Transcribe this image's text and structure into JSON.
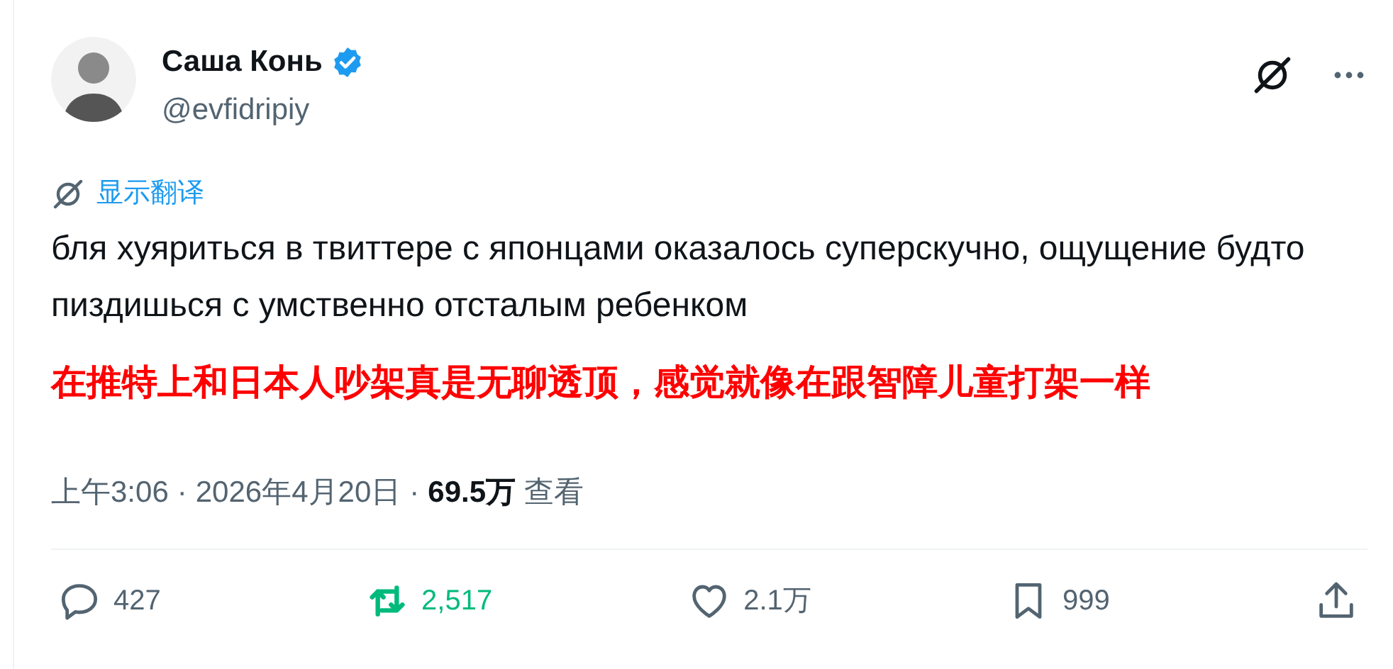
{
  "author": {
    "name": "Саша Конь",
    "verified": true,
    "handle": "@evfidripiy"
  },
  "translate_link": "显示翻译",
  "text": "бля хуяриться в твиттере с японцами оказалось суперскучно, ощущение будто пиздишься с умственно отсталым ребенком",
  "caption": "在推特上和日本人吵架真是无聊透顶，感觉就像在跟智障儿童打架一样",
  "meta": {
    "time": "上午3:06",
    "separator_1": "·",
    "date": "2026年4月20日",
    "separator_2": "·",
    "views": "69.5万",
    "views_label": "查看"
  },
  "actions": [
    {
      "kind": "reply",
      "count": "427",
      "active": false
    },
    {
      "kind": "repost",
      "count": "2,517",
      "active": true
    },
    {
      "kind": "like",
      "count": "2.1万",
      "active": false
    },
    {
      "kind": "bookmark",
      "count": "999",
      "active": false
    },
    {
      "kind": "share",
      "active": false
    }
  ]
}
